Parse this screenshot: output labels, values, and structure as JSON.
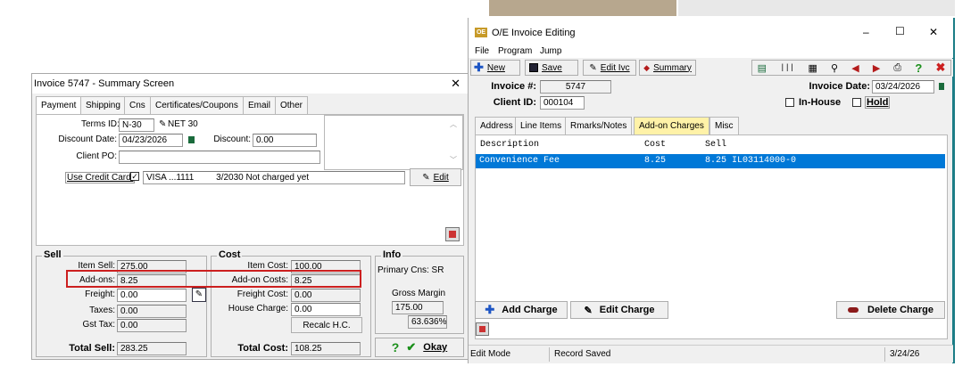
{
  "summary": {
    "title": "Invoice 5747 - Summary Screen",
    "close": "✕",
    "tabs": [
      "Payment",
      "Shipping",
      "Cns",
      "Certificates/Coupons",
      "Email",
      "Other"
    ],
    "terms_label": "Terms ID:",
    "terms_value": "N-30",
    "terms_desc": "NET 30",
    "discount_date_label": "Discount Date:",
    "discount_date": "04/23/2026",
    "discount_label": "Discount:",
    "discount_value": "0.00",
    "client_po_label": "Client PO:",
    "client_po": "",
    "use_cc_label": "Use Credit Card:",
    "card": "VISA ...1111",
    "card_info": "3/2030  Not charged yet",
    "edit_label": "Edit",
    "sell": {
      "title": "Sell",
      "item_sell_label": "Item Sell:",
      "item_sell": "275.00",
      "addons_label": "Add-ons:",
      "addons": "8.25",
      "freight_label": "Freight:",
      "freight": "0.00",
      "taxes_label": "Taxes:",
      "taxes": "0.00",
      "gst_label": "Gst Tax:",
      "gst": "0.00",
      "total_label": "Total Sell:",
      "total": "283.25"
    },
    "cost": {
      "title": "Cost",
      "item_cost_label": "Item Cost:",
      "item_cost": "100.00",
      "addon_costs_label": "Add-on Costs:",
      "addon_costs": "8.25",
      "freight_label": "Freight Cost:",
      "freight": "0.00",
      "house_label": "House Charge:",
      "house": "0.00",
      "recalc": "Recalc H.C.",
      "total_label": "Total Cost:",
      "total": "108.25"
    },
    "info": {
      "title": "Info",
      "primary_cns": "Primary Cns: SR",
      "gm_label": "Gross Margin",
      "gm_value": "175.00",
      "gm_pct": "63.636%"
    },
    "okay": "Okay"
  },
  "oe": {
    "title": "O/E Invoice Editing",
    "app_icon": "OE",
    "min": "–",
    "max": "☐",
    "close": "✕",
    "menu": [
      "File",
      "Program",
      "Jump"
    ],
    "toolbar": {
      "new": "New",
      "save": "Save",
      "edit_ivc": "Edit Ivc",
      "summary": "Summary"
    },
    "invoice_label": "Invoice #:",
    "invoice": "5747",
    "client_label": "Client ID:",
    "client": "000104",
    "invoice_date_label": "Invoice Date:",
    "invoice_date": "03/24/2026",
    "inhouse_label": "In-House",
    "hold_label": "Hold",
    "tabs": [
      "Address",
      "Line Items",
      "Rmarks/Notes",
      "Add-on Charges",
      "Misc"
    ],
    "table": {
      "headers": [
        "Description",
        "Cost",
        "Sell"
      ],
      "rows": [
        {
          "description": "Convenience Fee",
          "cost": "8.25",
          "sell": "8.25 IL03114000-0"
        }
      ]
    },
    "add_charge": "Add Charge",
    "edit_charge": "Edit Charge",
    "delete_charge": "Delete Charge",
    "status": {
      "mode": "Edit Mode",
      "message": "Record Saved",
      "date": "3/24/26"
    }
  },
  "colors": {
    "accent_red": "#cc1f1f",
    "selected_row": "#0078d7",
    "active_tab": "#fff2a8",
    "teal_border": "#1b7d86"
  }
}
